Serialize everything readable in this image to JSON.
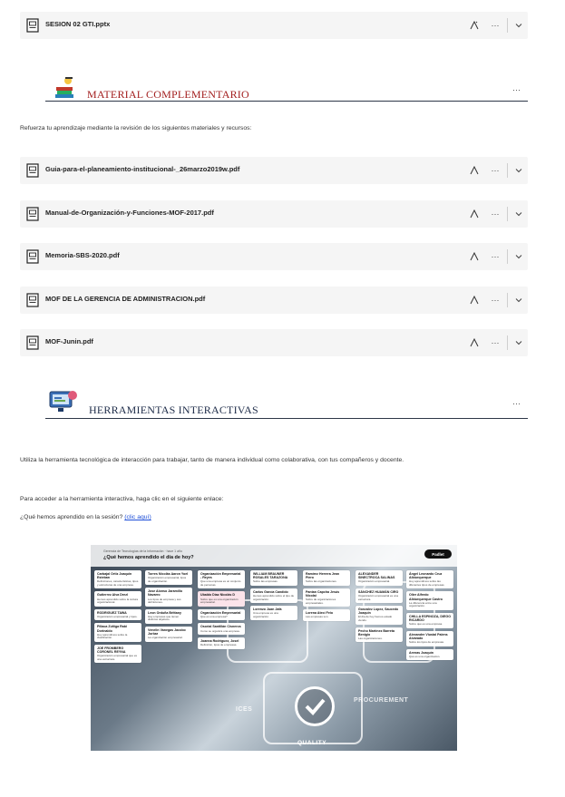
{
  "top_file": {
    "name": "SESION 02 GTI.pptx"
  },
  "material_section": {
    "title": "MATERIAL COMPLEMENTARIO",
    "intro": "Refuerza tu aprendizaje mediante la revisión de los siguientes materiales y recursos:",
    "files": [
      {
        "name": "Guia-para-el-planeamiento-institucional-_26marzo2019w.pdf"
      },
      {
        "name": "Manual-de-Organización-y-Funciones-MOF-2017.pdf"
      },
      {
        "name": "Memoria-SBS-2020.pdf"
      },
      {
        "name": "MOF DE LA GERENCIA DE ADMINISTRACION.pdf"
      },
      {
        "name": "MOF-Junin.pdf"
      }
    ]
  },
  "tools_section": {
    "title": "HERRAMIENTAS INTERACTIVAS",
    "intro": "Utiliza la herramienta tecnológica de interacción para trabajar, tanto de manera individual como colaborativa, con tus compañeros y docente.",
    "access_text": "Para acceder a la herramienta interactiva, haga clic en el siguiente enlace:",
    "question": "¿Qué hemos aprendido en la sesión?",
    "link_label": "(clic aquí)"
  },
  "board": {
    "small_header": "Gerencia de Tecnologías de la Información · hace 1 año",
    "title": "¿Qué hemos aprendido el día de hoy?",
    "logo": "Padlet",
    "bg_words": [
      "PROCUREMENT",
      "QUALITY",
      "ICES"
    ],
    "columns": [
      [
        {
          "name": "Carbajal Ortiz Joaquin Esteban",
          "text": "Definiciones, características, tipos y estructuras de una empresa."
        },
        {
          "name": "Gutierrez Alva Drezl",
          "text": "Hemos aprendido sobre la cultura organizacional."
        },
        {
          "name": "RODRIGUEZ TAWA",
          "text": "Organización empresarial y tipos."
        },
        {
          "name": "Pillaca Zúñiga Rabi Dorinaldo",
          "text": "Hoy aprendimos sobre la clasificación."
        },
        {
          "name": "JOE FROMBERG CORONEL REYNA",
          "text": "Organización empresarial que es una estructura."
        }
      ],
      [
        {
          "name": "Torres Nicolás Aaron Yoel",
          "text": "Organización empresarial, tipos de organización."
        },
        {
          "name": "Jose Alonso Jaramillo Navarro",
          "text": "Los tipos de empresa y sus definiciones."
        },
        {
          "name": "Leon Orduña Brittany",
          "text": "Hay empresas que tienen distintos objetivos."
        },
        {
          "name": "Venelin Vanegas Jacobo Jorbar",
          "text": "La organización empresarial."
        }
      ],
      [
        {
          "name": "Organización Empresarial - Reyes",
          "text": "Que una empresa es un conjunto de personas."
        },
        {
          "name": "Ubaldo Díaz Nicolás D",
          "text": "Sobre que es una organización empresarial.",
          "pink": true
        },
        {
          "name": "Organización Empresarial",
          "text": "Que es una empresa?"
        },
        {
          "name": "Osorial Santillán Cisneros",
          "text": "Como se organiza una empresa."
        },
        {
          "name": "Joanna Rodríguez, Josel",
          "text": "Definición, tipos de empresas."
        }
      ],
      [
        {
          "name": "WILLIAM BRAUNER ROSALES TARAZONA",
          "text": "Sobre las empresas."
        },
        {
          "name": "Carlos García Candido",
          "text": "Hemos aprendido sobre el tipo de organización."
        },
        {
          "name": "Lorenzo Juan Jafa",
          "text": "Una empresa es una organización."
        }
      ],
      [
        {
          "name": "Ramírez Herrera Jean Piero",
          "text": "Sobre las organizaciones."
        },
        {
          "name": "Pantan Capcha Jesús Nicolai",
          "text": "Sobre de organizaciones empresariales."
        },
        {
          "name": "Lorena Atecí Feio",
          "text": "Las empresas son."
        }
      ],
      [
        {
          "name": "ALEXANDER SINECTROCA SALINAS",
          "text": "Organización empresarial."
        },
        {
          "name": "SÁNCHEZ HUAMÁN CIRO",
          "text": "Organización empresarial es una estructura."
        },
        {
          "name": "Gonzalez Lopez, Saucedo Joaquin",
          "text": "El día de hoy hemos estado viendo."
        },
        {
          "name": "Pecho Martínez Barreta Benigio",
          "text": "Las organizaciones."
        }
      ],
      [
        {
          "name": "Ángel Leonardo Cruz Albiurquerque",
          "text": "Hoy aprendimos sobre las diferentes tipos de empresas."
        },
        {
          "name": "Olier Alfredo Albiurquerque Castro",
          "text": "La diferencia entre una organización."
        },
        {
          "name": "CHILLA ESPINOZA, DIEGO RICARDO",
          "text": "Sobre qué es una empresa."
        },
        {
          "name": "Alexandre Viustal Palens Alvarado",
          "text": "Sobre los tipos de empresas."
        },
        {
          "name": "Arenas Joaquín",
          "text": "Qué es una organización."
        }
      ]
    ]
  },
  "actions": {
    "menu": "···",
    "expand": "⌄",
    "rate": "A"
  }
}
